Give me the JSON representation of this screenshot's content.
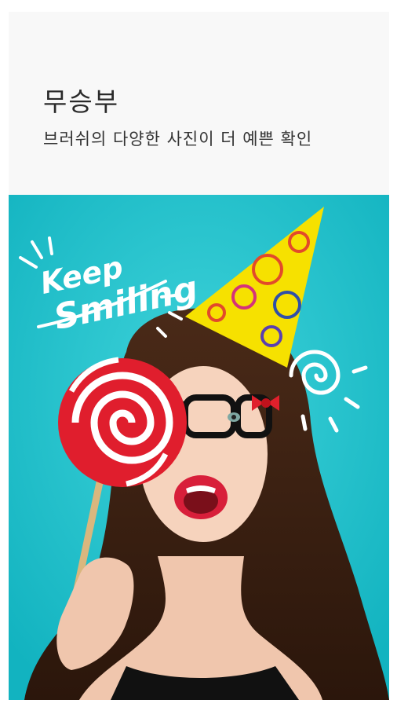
{
  "header": {
    "title": "무승부",
    "subtitle": "브러쉬의 다양한 사진이 더 예쁜 확인"
  },
  "photo": {
    "doodle_line1": "Keep",
    "doodle_line2": "Smiling",
    "background_color": "#21c5cf"
  }
}
